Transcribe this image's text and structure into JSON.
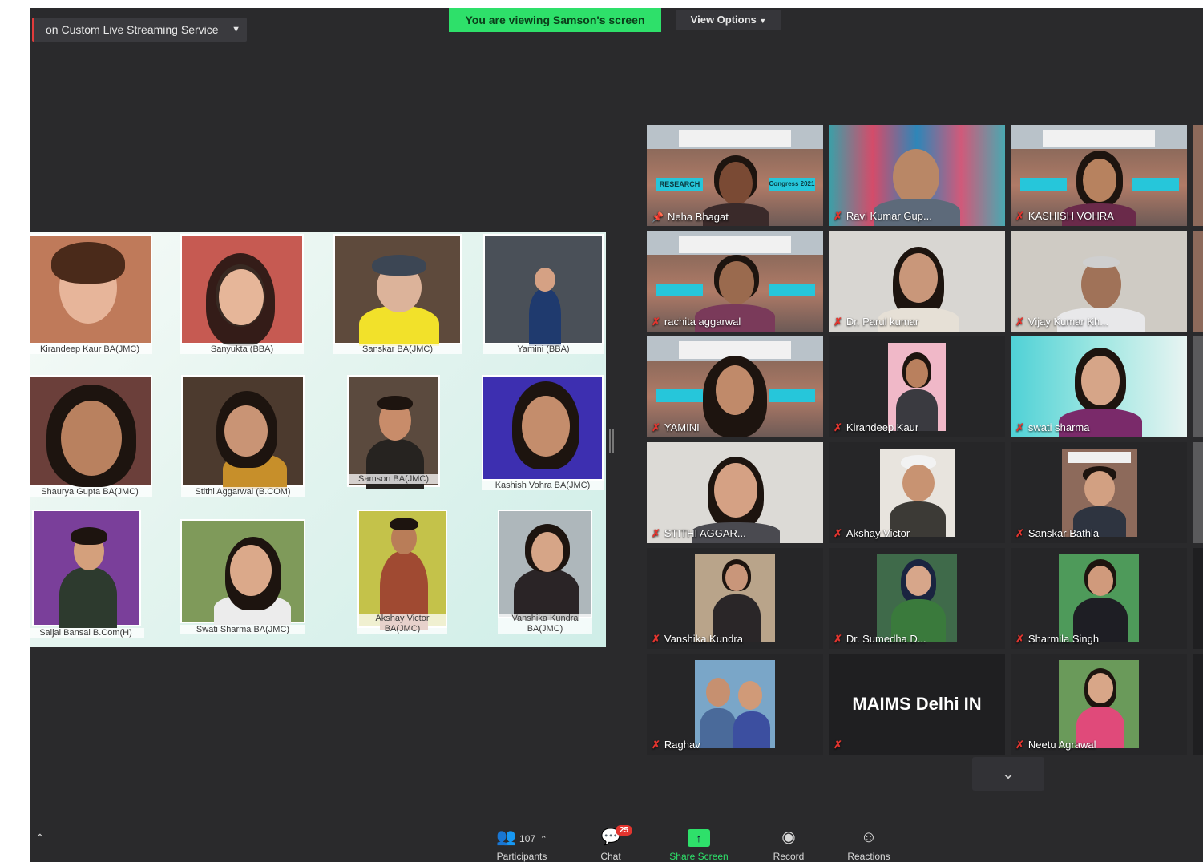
{
  "top": {
    "stream_label": "on Custom Live Streaming Service",
    "viewing_banner": "You are viewing Samson's screen",
    "view_options": "View Options"
  },
  "slide": {
    "students": [
      {
        "label": "Kirandeep Kaur BA(JMC)"
      },
      {
        "label": "Sanyukta (BBA)"
      },
      {
        "label": "Sanskar BA(JMC)"
      },
      {
        "label": "Yamini (BBA)"
      },
      {
        "label": "Shaurya Gupta BA(JMC)"
      },
      {
        "label": "Stithi Aggarwal (B.COM)"
      },
      {
        "label": "Samson BA(JMC)"
      },
      {
        "label": "Kashish Vohra BA(JMC)"
      },
      {
        "label": "Saijal Bansal B.Com(H)"
      },
      {
        "label": "Swati Sharma BA(JMC)"
      },
      {
        "label": "Akshay Victor BA(JMC)"
      },
      {
        "label": "Vanshika Kundra BA(JMC)"
      }
    ]
  },
  "gallery": {
    "participants": [
      {
        "name": "Neha Bhagat"
      },
      {
        "name": "Ravi Kumar Gup..."
      },
      {
        "name": "KASHISH VOHRA"
      },
      {
        "name": "rachita aggarwal"
      },
      {
        "name": "Dr. Parul kumar"
      },
      {
        "name": "Vijay Kumar Kh..."
      },
      {
        "name": "YAMINI"
      },
      {
        "name": "Kirandeep Kaur"
      },
      {
        "name": "swati sharma"
      },
      {
        "name": "STITHI AGGAR..."
      },
      {
        "name": "Akshay Victor"
      },
      {
        "name": "Sanskar Bathla"
      },
      {
        "name": "Vanshika Kundra"
      },
      {
        "name": "Dr. Sumedha D..."
      },
      {
        "name": "Sharmila Singh"
      },
      {
        "name": "Raghav"
      },
      {
        "name": "MAIMS Delhi IN"
      },
      {
        "name": "Neetu Agrawal"
      }
    ],
    "research_chip": "RESEARCH",
    "congress_chip": "Congress 2021"
  },
  "toolbar": {
    "participants_label": "Participants",
    "participants_count": "107",
    "chat_label": "Chat",
    "chat_badge": "25",
    "share_label": "Share Screen",
    "record_label": "Record",
    "reactions_label": "Reactions"
  },
  "colors": {
    "meeting_bg": "#2a2a2c",
    "active_speaker_outline": "#d6e64a",
    "share_green": "#2ee06a",
    "muted_red": "#e2352f"
  },
  "icons": [
    "chevron-down-icon",
    "muted-mic-icon",
    "pin-icon",
    "participants-icon",
    "chat-icon",
    "share-screen-icon",
    "record-icon",
    "reactions-icon",
    "chevron-up-icon"
  ]
}
